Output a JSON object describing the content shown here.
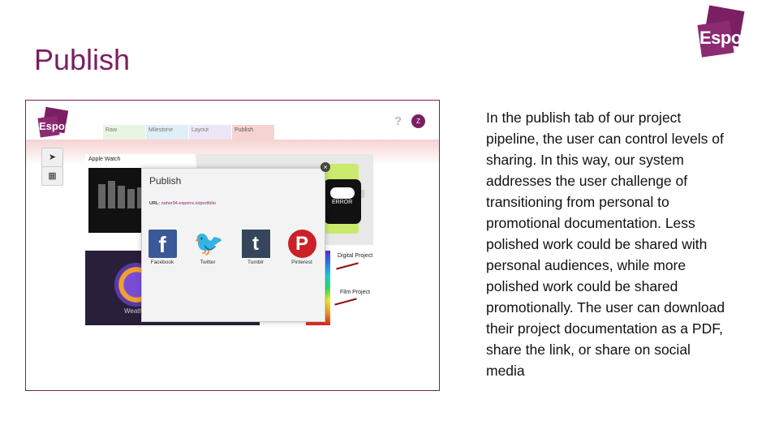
{
  "slide": {
    "title": "Publish",
    "body": "In the publish tab of our project pipeline, the user can control levels of sharing. In this way, our system addresses the user challenge of transitioning from personal to promotional documentation. Less polished work could be shared with personal audiences, while more polished work could be shared promotionally. The user can download their project documentation as a PDF, share the link, or share on social media"
  },
  "logo": {
    "text": "Esporre",
    "color": "#7a1f62"
  },
  "app": {
    "tabs": [
      {
        "label": "Raw",
        "color": "#e8f5e0"
      },
      {
        "label": "Milestone",
        "color": "#e0eef8"
      },
      {
        "label": "Layout",
        "color": "#eee6f6"
      },
      {
        "label": "Publish",
        "color": "#f6d3d3"
      }
    ],
    "help_label": "?",
    "avatar_initial": "Z",
    "weather_card_title": "Apple Watch",
    "watch_error_text": "ERROR",
    "purple_card_text": "Weath",
    "annotations": [
      "Digital Project",
      "Film Project"
    ],
    "publish_dialog": {
      "title": "Publish",
      "url_label": "URL:",
      "url_value": "naher94.esporre.io/portfolio",
      "close_label": "×",
      "social": [
        {
          "label": "Facebook",
          "glyph": "f",
          "icon": "facebook-icon"
        },
        {
          "label": "Twitter",
          "glyph": "🐦",
          "icon": "twitter-icon"
        },
        {
          "label": "Tumblr",
          "glyph": "t",
          "icon": "tumblr-icon"
        },
        {
          "label": "Pinterest",
          "glyph": "P",
          "icon": "pinterest-icon"
        }
      ]
    }
  }
}
